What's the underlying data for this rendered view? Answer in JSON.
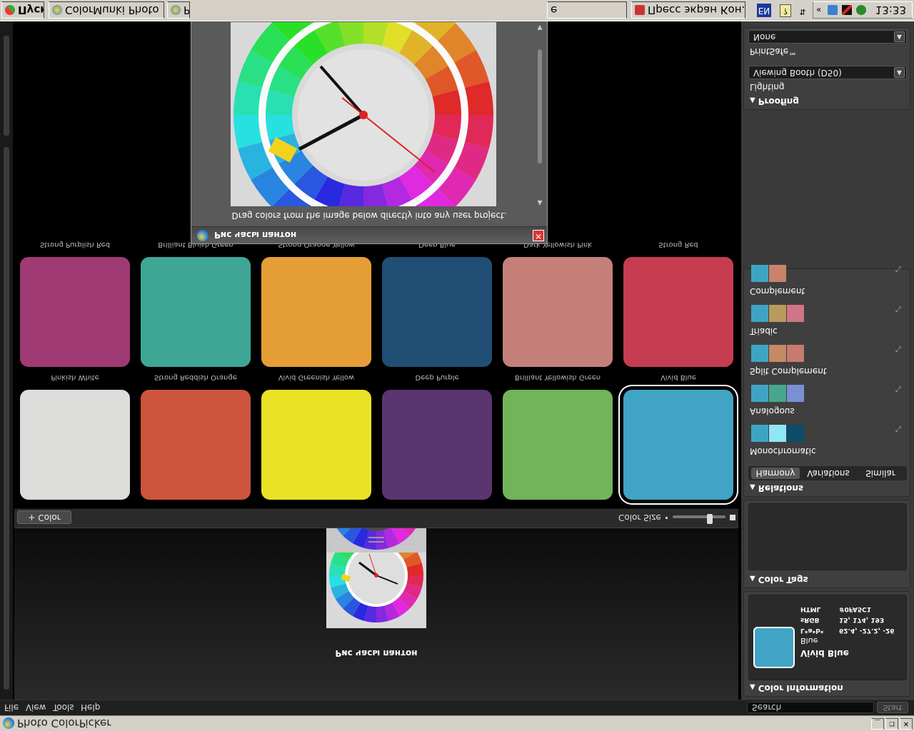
{
  "window": {
    "title": "Photo ColorPicker",
    "minimize": "_",
    "restore": "❐",
    "close": "✕"
  },
  "menu": {
    "items": [
      "File",
      "View",
      "Tools",
      "Help"
    ],
    "search_label": "Search",
    "search_button": "Start"
  },
  "palette": {
    "name": "Рис часы пантон"
  },
  "toolbar": {
    "add_color": "+ Color",
    "color_size": "Color Size"
  },
  "colors": [
    {
      "name": "Pinkish White",
      "hex": "#dcdcda"
    },
    {
      "name": "Strong Reddish Orange",
      "hex": "#cc543d"
    },
    {
      "name": "Vivid Greenish Yellow",
      "hex": "#e9e226"
    },
    {
      "name": "Deep Purple",
      "hex": "#5a3570"
    },
    {
      "name": "Brilliant Yellowish Green",
      "hex": "#71b45a"
    },
    {
      "name": "Vivid Blue",
      "hex": "#41a4c5",
      "selected": true
    },
    {
      "name": "Strong Purplish Red",
      "hex": "#9f3a74"
    },
    {
      "name": "Brilliant Bluish Green",
      "hex": "#3fa696"
    },
    {
      "name": "Strong Orange Yellow",
      "hex": "#e49e35"
    },
    {
      "name": "Deep Blue",
      "hex": "#214e75"
    },
    {
      "name": "Dark Yellowish Pink",
      "hex": "#c47f79"
    },
    {
      "name": "Strong Red",
      "hex": "#c63c51"
    }
  ],
  "color_information": {
    "header": "Color Information",
    "name": "Vivid Blue",
    "sub": "Blue",
    "swatch_hex": "#41a4c5",
    "rows": [
      {
        "k": "HTML",
        "v": "#0FA5C1"
      },
      {
        "k": "sRGB",
        "v": "15, 174, 193"
      },
      {
        "k": "L*a*b*",
        "v": "62.4, -27.2, -26"
      }
    ]
  },
  "color_tags": {
    "header": "Color Tags"
  },
  "relations": {
    "header": "Relations",
    "tabs": [
      "Harmony",
      "Variations",
      "Similar"
    ],
    "active_tab": 0,
    "rows": [
      {
        "label": "Monochromatic",
        "swatches": [
          "#3fa4c4",
          "#8fe6f6",
          "#0b4d68"
        ]
      },
      {
        "label": "Analogous",
        "swatches": [
          "#3fa4c4",
          "#46a78e",
          "#7b8fd6"
        ]
      },
      {
        "label": "Split Complement",
        "swatches": [
          "#3fa4c4",
          "#c38a63",
          "#c77a70"
        ]
      },
      {
        "label": "Triadic",
        "swatches": [
          "#3fa4c4",
          "#b89a5c",
          "#cf7585"
        ]
      },
      {
        "label": "Complement",
        "swatches": [
          "#3fa4c4",
          "#c8836a"
        ]
      }
    ],
    "expand_glyph": "⤡"
  },
  "proofing": {
    "header": "Proofing",
    "lighting_label": "Lighting",
    "lighting_value": "Viewing Booth (D50)",
    "printsafe_label": "PrintSafe™",
    "printsafe_value": "None"
  },
  "float_window": {
    "title": "Рис часы пантон",
    "hint": "Drag colors from the image below directly into any user project.",
    "close": "✕"
  },
  "taskbar": {
    "start": "Пуск",
    "buttons": [
      "ColorMunki Photo",
      "P",
      "e",
      "Пресс экран Кон..."
    ],
    "lang": "EN",
    "clock": "13:33"
  }
}
